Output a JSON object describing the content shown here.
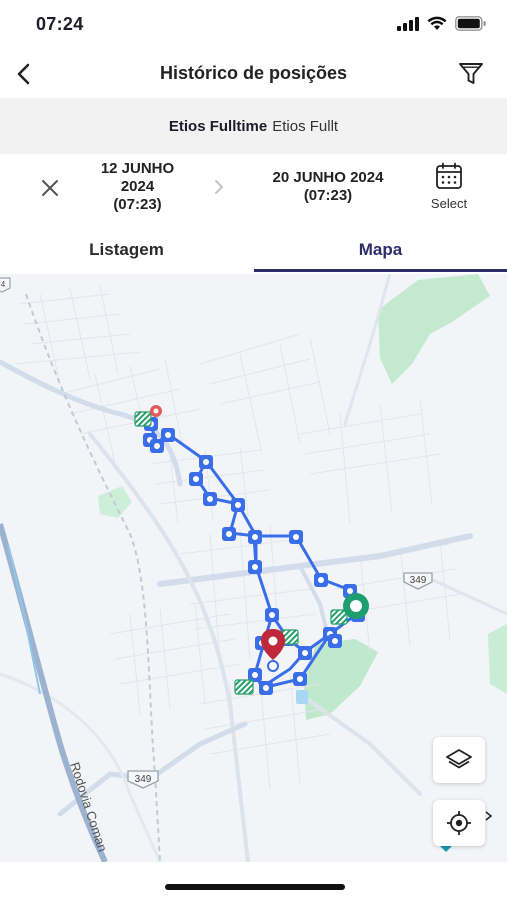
{
  "status_bar": {
    "time": "07:24"
  },
  "header": {
    "title": "Histórico de posições"
  },
  "vehicle": {
    "name": "Etios Fulltime",
    "plate": "Etios Fullt"
  },
  "date_range": {
    "start_line1": "12 JUNHO",
    "start_line2": "2024",
    "start_line3": "(07:23)",
    "end_line1": "20 JUNHO 2024",
    "end_line2": "(07:23)",
    "select_label": "Select"
  },
  "tabs": [
    {
      "label": "Listagem",
      "active": false
    },
    {
      "label": "Mapa",
      "active": true
    }
  ],
  "map": {
    "road_labels": {
      "highway_badge_1": "349",
      "highway_badge_2": "349",
      "highway_badge_3": "4",
      "rodovia": "Rodovia Coman"
    },
    "controls": {
      "layers": "layers-icon",
      "locate": "locate-icon"
    }
  },
  "colors": {
    "accent": "#2d2c6a",
    "route": "#3a6ee8",
    "end_pin": "#c0293b",
    "start_pin": "#1e9e6e",
    "map_bg": "#f2f4f7",
    "park": "#bde7cf"
  }
}
